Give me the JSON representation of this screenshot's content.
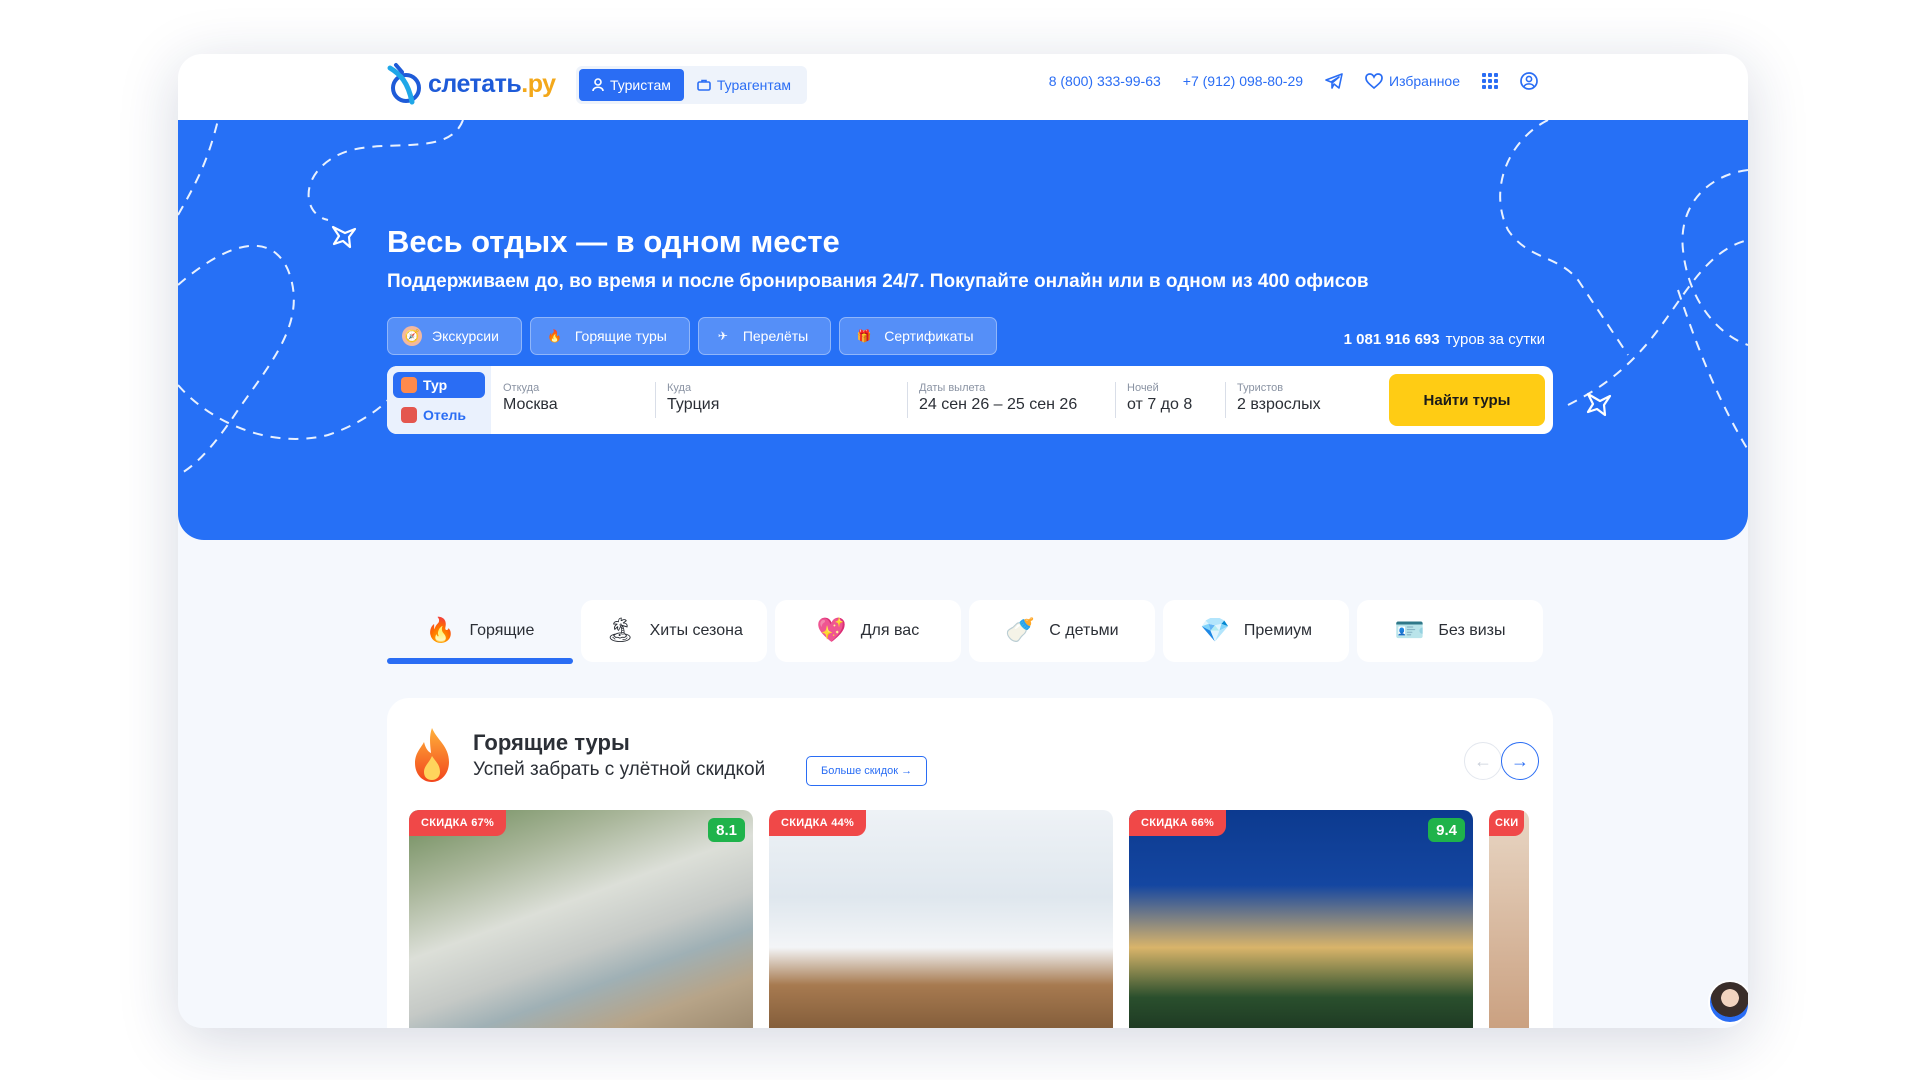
{
  "brand": {
    "name": "слетать",
    "tld": ".ру"
  },
  "header": {
    "roles": [
      {
        "label": "Туристам",
        "active": true
      },
      {
        "label": "Турагентам",
        "active": false
      }
    ],
    "phone1": "8 (800) 333-99-63",
    "phone2": "+7 (912) 098-80-29",
    "favorites": "Избранное",
    "icons": [
      "telegram-icon",
      "heart-icon",
      "grid-menu-icon",
      "user-profile-icon"
    ]
  },
  "hero": {
    "title": "Весь отдых — в одном месте",
    "subtitle": "Поддерживаем до, во время и после бронирования 24/7. Покупайте онлайн или в одном из 400 офисов",
    "chips": [
      {
        "label": "Экскурсии",
        "icon": "compass-icon"
      },
      {
        "label": "Горящие туры",
        "icon": "flame-icon"
      },
      {
        "label": "Перелёты",
        "icon": "airplane-icon"
      },
      {
        "label": "Сертификаты",
        "icon": "gift-icon"
      }
    ],
    "tours_count": "1 081 916 693",
    "tours_count_suffix": "туров за сутки"
  },
  "search": {
    "modes": [
      {
        "label": "Тур",
        "active": true
      },
      {
        "label": "Отель",
        "active": false
      }
    ],
    "from": {
      "label": "Откуда",
      "value": "Москва"
    },
    "to": {
      "label": "Куда",
      "value": "Турция"
    },
    "dates": {
      "label": "Даты вылета",
      "value": "24 сен 26 – 25 сен 26"
    },
    "nights": {
      "label": "Ночей",
      "value": "от 7 до 8"
    },
    "tourists": {
      "label": "Туристов",
      "value": "2 взрослых"
    },
    "submit": "Найти туры"
  },
  "categories": [
    {
      "label": "Горящие",
      "icon": "🔥",
      "active": true
    },
    {
      "label": "Хиты сезона",
      "icon": "🏝",
      "active": false
    },
    {
      "label": "Для вас",
      "icon": "💖",
      "active": false
    },
    {
      "label": "С детьми",
      "icon": "🍼",
      "active": false
    },
    {
      "label": "Премиум",
      "icon": "💎",
      "active": false
    },
    {
      "label": "Без визы",
      "icon": "🪪",
      "active": false
    }
  ],
  "hot": {
    "title": "Горящие туры",
    "subtitle": "Успей забрать с улётной скидкой",
    "more": "Больше скидок →",
    "prev": "←",
    "next": "→",
    "cards": [
      {
        "discount": "СКИДКА 67%",
        "rating": "8.1"
      },
      {
        "discount": "СКИДКА 44%",
        "rating": ""
      },
      {
        "discount": "СКИДКА 66%",
        "rating": "9.4"
      },
      {
        "discount": "СКИ",
        "rating": ""
      }
    ]
  },
  "colors": {
    "primary": "#2670f6",
    "accent": "#ffcc14",
    "discount": "#f04848",
    "rating": "#1fb34b"
  }
}
